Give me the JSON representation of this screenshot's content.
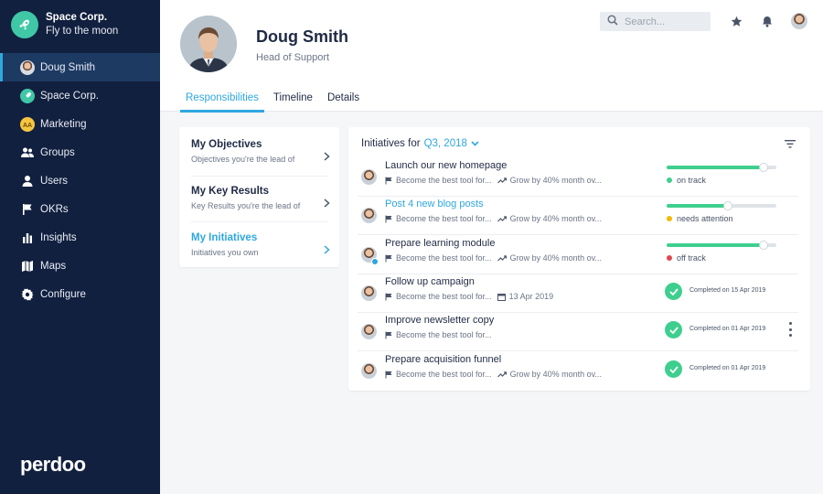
{
  "org": {
    "name": "Space Corp.",
    "tagline": "Fly to the moon",
    "icon": "rocket-icon"
  },
  "nav": [
    {
      "label": "Doug Smith",
      "icon": "avatar-icon",
      "active": true
    },
    {
      "label": "Space Corp.",
      "icon": "rocket-icon"
    },
    {
      "label": "Marketing",
      "icon": "team-badge-icon"
    },
    {
      "label": "Groups",
      "icon": "groups-icon"
    },
    {
      "label": "Users",
      "icon": "user-icon"
    },
    {
      "label": "OKRs",
      "icon": "flag-icon"
    },
    {
      "label": "Insights",
      "icon": "bar-chart-icon"
    },
    {
      "label": "Maps",
      "icon": "map-icon"
    },
    {
      "label": "Configure",
      "icon": "gear-icon"
    }
  ],
  "brand": "perdoo",
  "search": {
    "placeholder": "Search..."
  },
  "profile": {
    "name": "Doug Smith",
    "role": "Head of Support"
  },
  "tabs": [
    "Responsibilities",
    "Timeline",
    "Details"
  ],
  "objectives_menu": [
    {
      "title": "My Objectives",
      "subtitle": "Objectives you're the lead of"
    },
    {
      "title": "My Key Results",
      "subtitle": "Key Results you're the lead of"
    },
    {
      "title": "My Initiatives",
      "subtitle": "Initiatives you own",
      "active": true
    }
  ],
  "initiatives": {
    "heading": "Initiatives for",
    "period": "Q3, 2018",
    "rows": [
      {
        "title": "Launch our new homepage",
        "objective": "Become the best tool for...",
        "metric": "Grow by 40% month ov...",
        "progress": 0.88,
        "status": "on track",
        "status_color": "#3ecf8e"
      },
      {
        "title": "Post 4 new blog posts",
        "objective": "Become the best tool for...",
        "metric": "Grow by 40% month ov...",
        "progress": 0.56,
        "status": "needs attention",
        "status_color": "#f5b800",
        "link": true
      },
      {
        "title": "Prepare learning module",
        "objective": "Become the best tool for...",
        "metric": "Grow by 40% month ov...",
        "progress": 0.88,
        "status": "off track",
        "status_color": "#e0484f"
      },
      {
        "title": "Follow up campaign",
        "objective": "Become the best tool for...",
        "date": "13 Apr 2019",
        "completed": "Completed on 15 Apr 2019"
      },
      {
        "title": "Improve newsletter copy",
        "objective": "Become the best tool for...",
        "completed": "Completed on 01 Apr 2019"
      },
      {
        "title": "Prepare acquisition funnel",
        "objective": "Become the best tool for...",
        "metric": "Grow by 40% month ov...",
        "completed": "Completed on 01 Apr 2019"
      }
    ]
  },
  "colors": {
    "sidebar": "#12203f",
    "accent": "#2ea7e0",
    "success": "#3ecf8e"
  }
}
